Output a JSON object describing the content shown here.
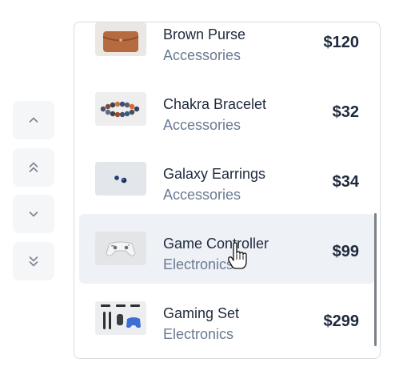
{
  "controls": [
    {
      "icon": "chevron-up-icon",
      "label": "Move up"
    },
    {
      "icon": "double-chevron-up-icon",
      "label": "Move to top"
    },
    {
      "icon": "chevron-down-icon",
      "label": "Move down"
    },
    {
      "icon": "double-chevron-down-icon",
      "label": "Move to bottom"
    }
  ],
  "products": [
    {
      "name": "Brown Purse",
      "category": "Accessories",
      "price": "$120",
      "image": "brown-purse"
    },
    {
      "name": "Chakra Bracelet",
      "category": "Accessories",
      "price": "$32",
      "image": "bracelet"
    },
    {
      "name": "Galaxy Earrings",
      "category": "Accessories",
      "price": "$34",
      "image": "earrings"
    },
    {
      "name": "Game Controller",
      "category": "Electronics",
      "price": "$99",
      "image": "game-controller",
      "hovered": true
    },
    {
      "name": "Gaming Set",
      "category": "Electronics",
      "price": "$299",
      "image": "gaming-set"
    }
  ],
  "colors": {
    "text": "#1f2a3d",
    "muted": "#6a7a92",
    "hover_row": "#eef1f6",
    "control_bg": "#f5f6f8",
    "icon": "#7a8294"
  }
}
